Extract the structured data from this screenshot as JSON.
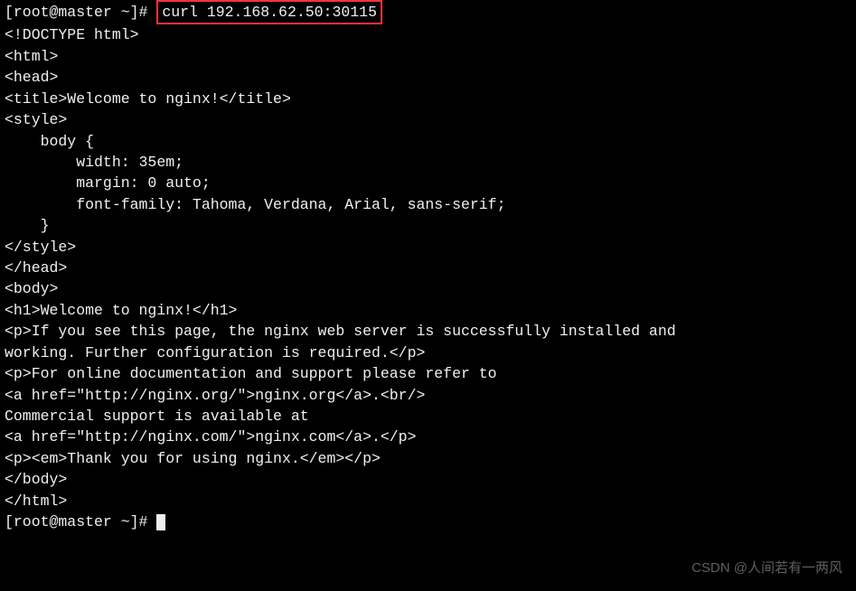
{
  "terminal": {
    "topFragment": "",
    "prompt1_user": "[root@master ~]# ",
    "command": "curl 192.168.62.50:30115",
    "output": [
      "<!DOCTYPE html>",
      "<html>",
      "<head>",
      "<title>Welcome to nginx!</title>",
      "<style>",
      "    body {",
      "        width: 35em;",
      "        margin: 0 auto;",
      "        font-family: Tahoma, Verdana, Arial, sans-serif;",
      "    }",
      "</style>",
      "</head>",
      "<body>",
      "<h1>Welcome to nginx!</h1>",
      "<p>If you see this page, the nginx web server is successfully installed and",
      "working. Further configuration is required.</p>",
      "",
      "<p>For online documentation and support please refer to",
      "<a href=\"http://nginx.org/\">nginx.org</a>.<br/>",
      "Commercial support is available at",
      "<a href=\"http://nginx.com/\">nginx.com</a>.</p>",
      "",
      "<p><em>Thank you for using nginx.</em></p>",
      "</body>",
      "</html>"
    ],
    "prompt2_user": "[root@master ~]# "
  },
  "watermark": "CSDN @人间若有一两风"
}
